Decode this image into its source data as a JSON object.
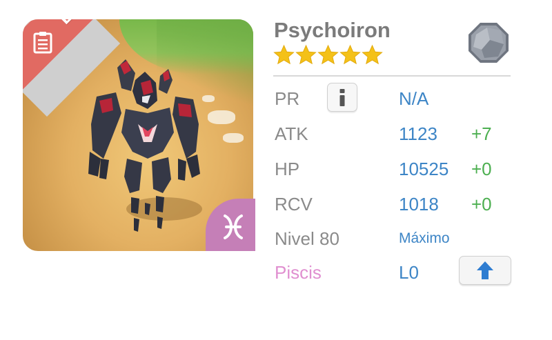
{
  "portrait": {
    "rarity": "Épico",
    "image": "monster-portrait",
    "zodiac_icon": "pisces-icon",
    "clipboard_icon": "clipboard-icon"
  },
  "monster": {
    "name": "Psychoiron",
    "stars": 5,
    "element_icon": "earth-stone-icon"
  },
  "stats": [
    {
      "label": "PR",
      "value": "N/A",
      "bonus": ""
    },
    {
      "label": "ATK",
      "value": "1123",
      "bonus": "+7"
    },
    {
      "label": "HP",
      "value": "10525",
      "bonus": "+0"
    },
    {
      "label": "RCV",
      "value": "1018",
      "bonus": "+0"
    }
  ],
  "level": {
    "label": "Nivel 80",
    "status": "Máximo"
  },
  "sign": {
    "label": "Piscis",
    "value": "L0"
  },
  "colors": {
    "value_blue": "#3d85c6",
    "bonus_green": "#4caf50",
    "label_gray": "#8a8a8a",
    "sign_pink": "#e08fd0",
    "star_gold": "#f4c118",
    "ribbon_red": "#e16a62"
  }
}
